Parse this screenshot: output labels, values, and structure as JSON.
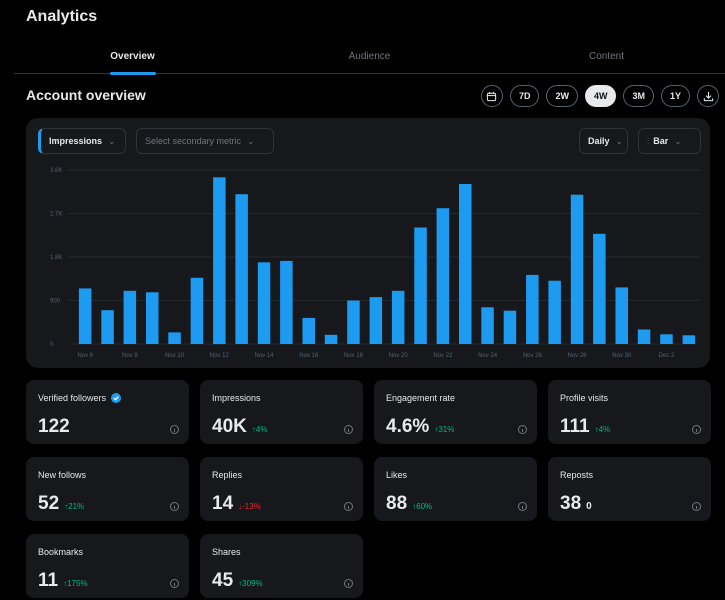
{
  "app": {
    "title": "Analytics"
  },
  "tabs": [
    {
      "label": "Overview",
      "active": true
    },
    {
      "label": "Audience",
      "active": false
    },
    {
      "label": "Content",
      "active": false
    }
  ],
  "section": {
    "title": "Account overview"
  },
  "ranges": [
    {
      "label": "7D",
      "active": false
    },
    {
      "label": "2W",
      "active": false
    },
    {
      "label": "4W",
      "active": true
    },
    {
      "label": "3M",
      "active": false
    },
    {
      "label": "1Y",
      "active": false
    }
  ],
  "range_icons": {
    "calendar": "calendar-icon",
    "export": "download-icon"
  },
  "controls": {
    "primary_metric": "Impressions",
    "secondary_placeholder": "Select secondary metric",
    "interval": "Daily",
    "chart_type": "Bar",
    "chart_type_icon": "bar-chart-icon"
  },
  "colors": {
    "accent": "#1d9bf0",
    "positive": "#00ba7c",
    "negative": "#f4212e",
    "card_bg": "#16181c"
  },
  "chart_data": {
    "type": "bar",
    "ylim": [
      0,
      3600
    ],
    "yticks": [
      "0",
      "900",
      "1.8K",
      "2.7K",
      "3.6K"
    ],
    "xtick_labels": [
      "Nov 6",
      "Nov 8",
      "Nov 10",
      "Nov 12",
      "Nov 14",
      "Nov 16",
      "Nov 18",
      "Nov 20",
      "Nov 22",
      "Nov 24",
      "Nov 26",
      "Nov 28",
      "Nov 30",
      "Dec 2"
    ],
    "categories": [
      "Nov 6",
      "Nov 7",
      "Nov 8",
      "Nov 9",
      "Nov 10",
      "Nov 11",
      "Nov 12",
      "Nov 13",
      "Nov 14",
      "Nov 15",
      "Nov 16",
      "Nov 17",
      "Nov 18",
      "Nov 19",
      "Nov 20",
      "Nov 21",
      "Nov 22",
      "Nov 23",
      "Nov 24",
      "Nov 25",
      "Nov 26",
      "Nov 27",
      "Nov 28",
      "Nov 29",
      "Nov 30",
      "Dec 1",
      "Dec 2",
      "Dec 3"
    ],
    "series": [
      {
        "values": [
          1150,
          700,
          1100,
          1070,
          240,
          1370,
          3450,
          3100,
          1690,
          1720,
          540,
          190,
          900,
          970,
          1100,
          2410,
          2810,
          3310,
          760,
          690,
          1430,
          1310,
          3090,
          2280,
          1170,
          300,
          200,
          180
        ]
      }
    ],
    "grid": true
  },
  "stats": [
    {
      "label": "Verified followers",
      "value": "122",
      "delta": "",
      "trend": "none",
      "verified": true
    },
    {
      "label": "Impressions",
      "value": "40K",
      "delta": "↑4%",
      "trend": "up",
      "verified": false
    },
    {
      "label": "Engagement rate",
      "value": "4.6%",
      "delta": "↑31%",
      "trend": "up",
      "verified": false
    },
    {
      "label": "Profile visits",
      "value": "111",
      "delta": "↑4%",
      "trend": "up",
      "verified": false
    },
    {
      "label": "New follows",
      "value": "52",
      "delta": "↑21%",
      "trend": "up",
      "verified": false
    },
    {
      "label": "Replies",
      "value": "14",
      "delta": "↓-13%",
      "trend": "down",
      "verified": false
    },
    {
      "label": "Likes",
      "value": "88",
      "delta": "↑60%",
      "trend": "up",
      "verified": false
    },
    {
      "label": "Reposts",
      "value": "38",
      "delta": "0",
      "trend": "flat",
      "verified": false
    },
    {
      "label": "Bookmarks",
      "value": "11",
      "delta": "↑175%",
      "trend": "up",
      "verified": false
    },
    {
      "label": "Shares",
      "value": "45",
      "delta": "↑309%",
      "trend": "up",
      "verified": false
    }
  ]
}
